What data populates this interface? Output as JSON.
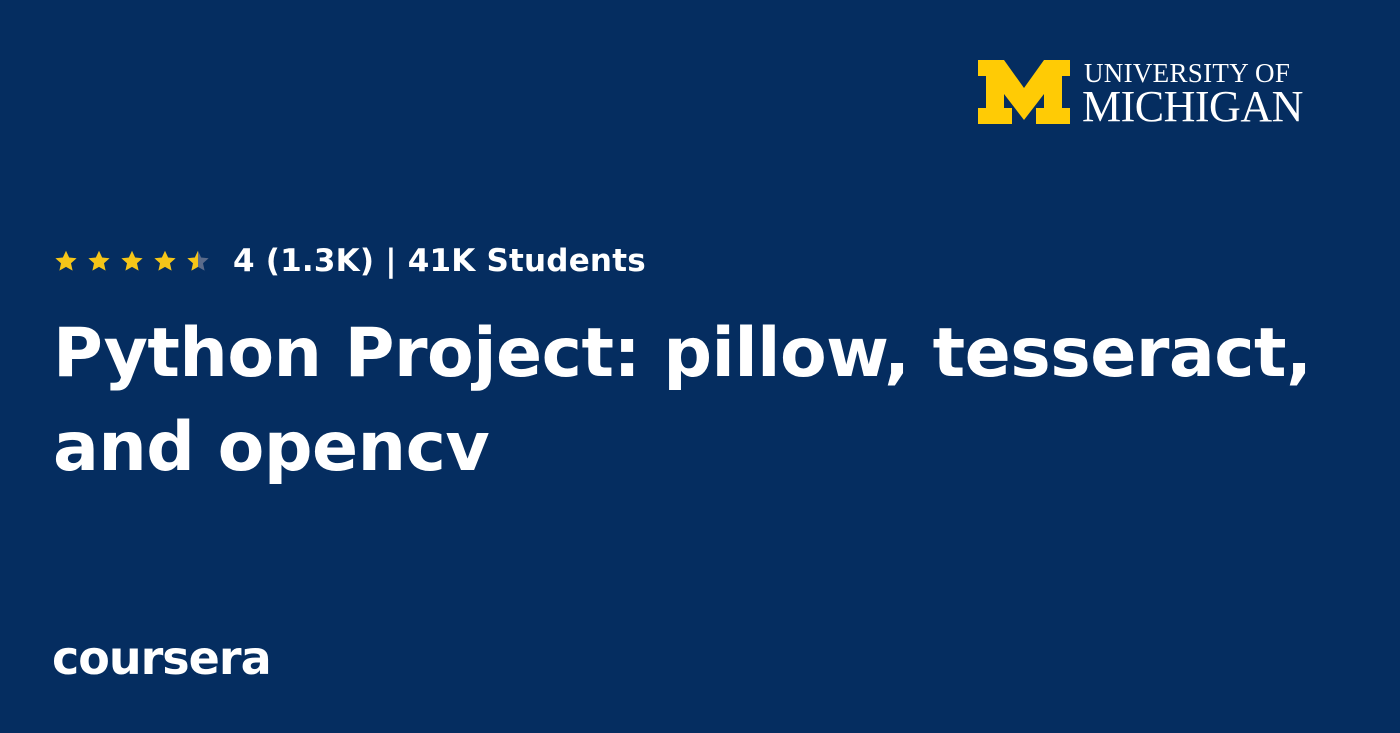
{
  "partner": {
    "line1": "UNIVERSITY OF",
    "line2": "MICHIGAN",
    "brand_color": "#ffcb05"
  },
  "rating": {
    "stars": 4,
    "text": "4 (1.3K) | 41K Students",
    "star_color": "#f5c518",
    "empty_color": "#5b6b8a"
  },
  "course": {
    "title": "Python Project: pillow, tesseract, and opencv"
  },
  "brand": {
    "name": "coursera"
  },
  "colors": {
    "background": "#052d60",
    "text": "#ffffff"
  }
}
